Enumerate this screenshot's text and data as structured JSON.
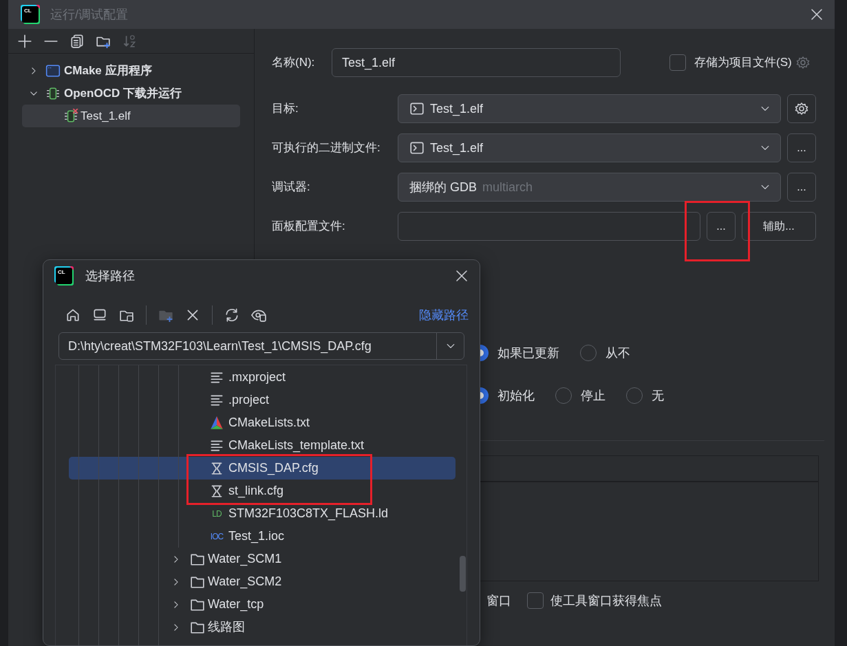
{
  "window": {
    "logo_text": "CL",
    "title": "运行/调试配置"
  },
  "toolbar": [
    {
      "kind": "add",
      "disabled": false
    },
    {
      "kind": "remove",
      "disabled": false
    },
    {
      "kind": "copy",
      "disabled": false
    },
    {
      "kind": "new-folder",
      "disabled": false
    },
    {
      "kind": "sort",
      "disabled": true
    }
  ],
  "config_tree": [
    {
      "label": "CMake 应用程序",
      "kind": "app",
      "expanded": false,
      "selected": false
    },
    {
      "label": "OpenOCD 下载并运行",
      "kind": "chip",
      "expanded": true,
      "selected": false,
      "children": [
        {
          "label": "Test_1.elf",
          "kind": "chip",
          "selected": true,
          "error": true
        }
      ]
    }
  ],
  "form": {
    "name_label": "名称(N):",
    "name_value": "Test_1.elf",
    "store_label": "存储为项目文件(S)",
    "store_checked": false,
    "target_label": "目标:",
    "target_value": "Test_1.elf",
    "executable_label": "可执行的二进制文件:",
    "executable_value": "Test_1.elf",
    "executable_browse": "...",
    "debugger_label": "调试器:",
    "debugger_value": "捆绑的 GDB",
    "debugger_hint": "multiarch",
    "debugger_browse": "...",
    "board_label": "面板配置文件:",
    "board_browse": "...",
    "board_browse_highlighted": true,
    "board_assist": "辅助..."
  },
  "radio_groups": [
    {
      "options": [
        {
          "label": "如果已更新",
          "selected": true
        },
        {
          "label": "从不",
          "selected": false
        }
      ]
    },
    {
      "options": [
        {
          "label": "初始化",
          "selected": true
        },
        {
          "label": "停止",
          "selected": false
        },
        {
          "label": "无",
          "selected": false
        }
      ]
    }
  ],
  "bottom_options": {
    "partial_text": "窗口",
    "focus_label": "使工具窗口获得焦点",
    "focus_checked": false
  },
  "dialog": {
    "logo_text": "CL",
    "title": "选择路径",
    "hide_path_link": "隐藏路径",
    "path": "D:\\hty\\creat\\STM32F103\\Learn\\Test_1\\CMSIS_DAP.cfg",
    "toolbar_groups": [
      [
        {
          "kind": "home",
          "disabled": false
        },
        {
          "kind": "desktop",
          "disabled": false
        },
        {
          "kind": "project",
          "disabled": false
        }
      ],
      [
        {
          "kind": "new-folder",
          "disabled": true
        },
        {
          "kind": "delete",
          "disabled": false
        }
      ],
      [
        {
          "kind": "refresh",
          "disabled": false
        },
        {
          "kind": "show-hidden",
          "disabled": false
        }
      ]
    ],
    "files": [
      {
        "name": ".mxproject",
        "kind": "text",
        "selected": false,
        "highlighted": false
      },
      {
        "name": ".project",
        "kind": "text",
        "selected": false,
        "highlighted": false
      },
      {
        "name": "CMakeLists.txt",
        "kind": "cmake",
        "selected": false,
        "highlighted": false
      },
      {
        "name": "CMakeLists_template.txt",
        "kind": "text",
        "selected": false,
        "highlighted": false
      },
      {
        "name": "CMSIS_DAP.cfg",
        "kind": "cfg",
        "selected": true,
        "highlighted": true
      },
      {
        "name": "st_link.cfg",
        "kind": "cfg",
        "selected": false,
        "highlighted": true
      },
      {
        "name": "STM32F103C8TX_FLASH.ld",
        "kind": "badge",
        "badge": "LD",
        "color": "#5fb865",
        "selected": false,
        "highlighted": false
      },
      {
        "name": "Test_1.ioc",
        "kind": "badge",
        "badge": "IOC",
        "color": "#548af7",
        "selected": false,
        "highlighted": false
      }
    ],
    "folders": [
      {
        "name": "Water_SCM1",
        "expanded": false
      },
      {
        "name": "Water_SCM2",
        "expanded": false
      },
      {
        "name": "Water_tcp",
        "expanded": false
      },
      {
        "name": "线路图",
        "expanded": false
      }
    ]
  }
}
